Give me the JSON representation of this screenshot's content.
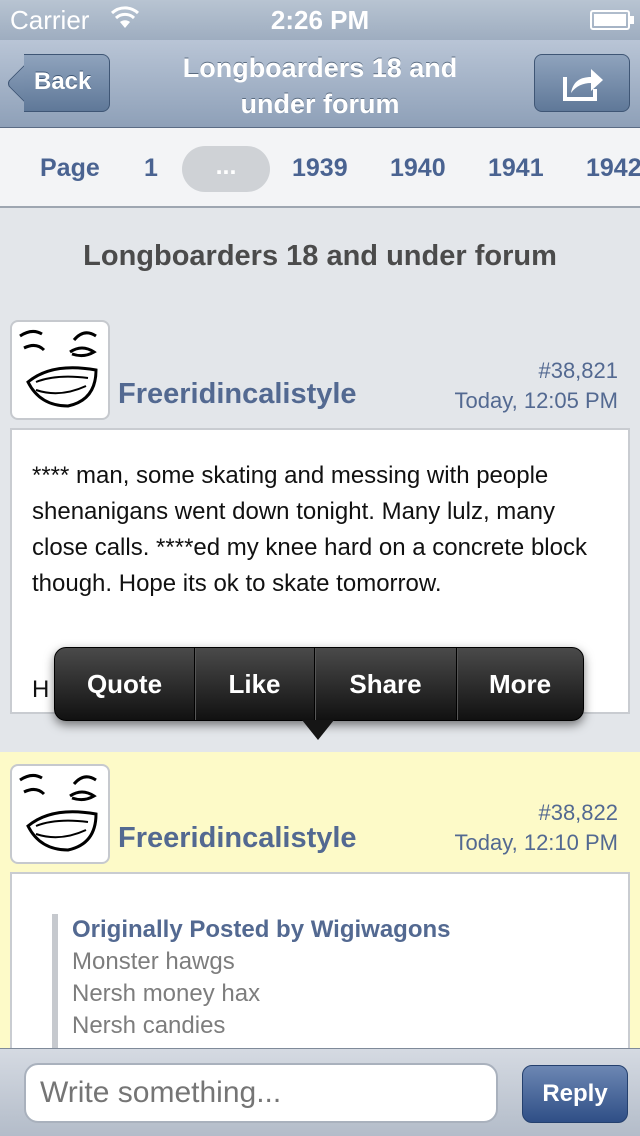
{
  "status_bar": {
    "carrier": "Carrier",
    "time": "2:26 PM",
    "wifi_icon": "wifi-icon",
    "battery_icon": "battery-icon"
  },
  "nav": {
    "back_label": "Back",
    "title": "Longboarders 18 and under forum",
    "share_icon": "share-icon"
  },
  "pager": {
    "page_label": "Page",
    "pages": [
      "1",
      "...",
      "1939",
      "1940",
      "1941",
      "1942"
    ]
  },
  "thread_title": "Longboarders 18 and under forum",
  "posts": [
    {
      "username": "Freeridincalistyle",
      "number": "#38,821",
      "date": "Today, 12:05 PM",
      "body": "**** man, some skating and messing with people shenanigans went down tonight. Many lulz, many close calls. ****ed my knee hard on a concrete block though. Hope its ok to skate tomorrow.",
      "cutoff": "H"
    },
    {
      "username": "Freeridincalistyle",
      "number": "#38,822",
      "date": "Today, 12:10 PM",
      "quote_header": "Originally Posted by Wigiwagons",
      "quote_lines": [
        "Monster hawgs",
        "Nersh money hax",
        "Nersh candies"
      ]
    }
  ],
  "popup_menu": [
    "Quote",
    "Like",
    "Share",
    "More"
  ],
  "compose": {
    "placeholder": "Write something...",
    "reply_label": "Reply"
  },
  "colors": {
    "link_blue": "#536991",
    "highlight_post": "#fdfac8",
    "nav_bar": "#8ea0b8"
  }
}
